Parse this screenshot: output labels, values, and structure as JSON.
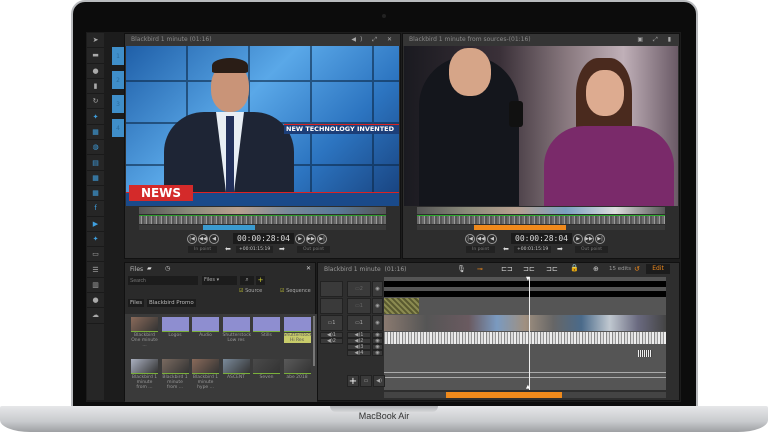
{
  "device": {
    "label": "MacBook Air"
  },
  "sidebar": {
    "icons": [
      "blackbird-logo-icon",
      "folder-icon",
      "help-icon",
      "trash-icon",
      "history-icon",
      "twitter-icon",
      "calendar-icon",
      "globe-icon",
      "document-icon",
      "calendar-icon",
      "calendar-icon",
      "facebook-icon",
      "youtube-icon",
      "twitter-icon",
      "keyboard-icon",
      "list-icon",
      "chart-icon",
      "info-icon",
      "chat-icon"
    ]
  },
  "tabs": [
    "1",
    "2",
    "3",
    "4"
  ],
  "left_viewer": {
    "title": "Blackbird 1 minute (01:16)",
    "timecode": "00:00:28:04",
    "offset": "+00:01:15:19",
    "in_label": "In point",
    "out_label": "Out point",
    "lower_third": "NEW TECHNOLOGY INVENTED",
    "news_label": "NEWS",
    "progress_color": "#3a9bd0"
  },
  "right_viewer": {
    "title": "Blackbird 1 minute from sources-(01:16)",
    "timecode": "00:00:28:04",
    "offset": "+00:01:15:19",
    "in_label": "In point",
    "out_label": "Out point",
    "progress_color": "#f08a1c"
  },
  "files": {
    "title": "Files",
    "search_placeholder": "Search",
    "filter": "Files",
    "source_label": "Source",
    "sequence_label": "Sequence",
    "source_checked": true,
    "sequence_checked": true,
    "breadcrumbs": [
      "Files",
      "Blackbird Promo"
    ],
    "items": [
      {
        "name": "Blackbird One minute ...",
        "type": "video"
      },
      {
        "name": "Logos",
        "type": "folder"
      },
      {
        "name": "Audio",
        "type": "folder"
      },
      {
        "name": "Shutterstock Low res",
        "type": "folder"
      },
      {
        "name": "Stills",
        "type": "folder"
      },
      {
        "name": "Shutterstock Hi Res",
        "type": "folder",
        "selected": true
      },
      {
        "name": "Blackbird 1 minute from ...",
        "type": "video"
      },
      {
        "name": "Blackbird 1 minute from ...",
        "type": "video"
      },
      {
        "name": "Blackbird 1 minute hype ...",
        "type": "video"
      },
      {
        "name": "ASCENT",
        "type": "video"
      },
      {
        "name": "Seven",
        "type": "video"
      },
      {
        "name": "abe 2018",
        "type": "video"
      }
    ]
  },
  "timeline": {
    "title": "Blackbird 1 minute",
    "duration": "(01:16)",
    "edits": "15 edits",
    "mode_button": "Edit",
    "video_tracks": [
      "1",
      "2",
      "1"
    ],
    "audio_tracks": [
      "1",
      "2",
      "3",
      "4"
    ],
    "source_audio": [
      "1",
      "2"
    ],
    "accent": "#f08a1c"
  }
}
